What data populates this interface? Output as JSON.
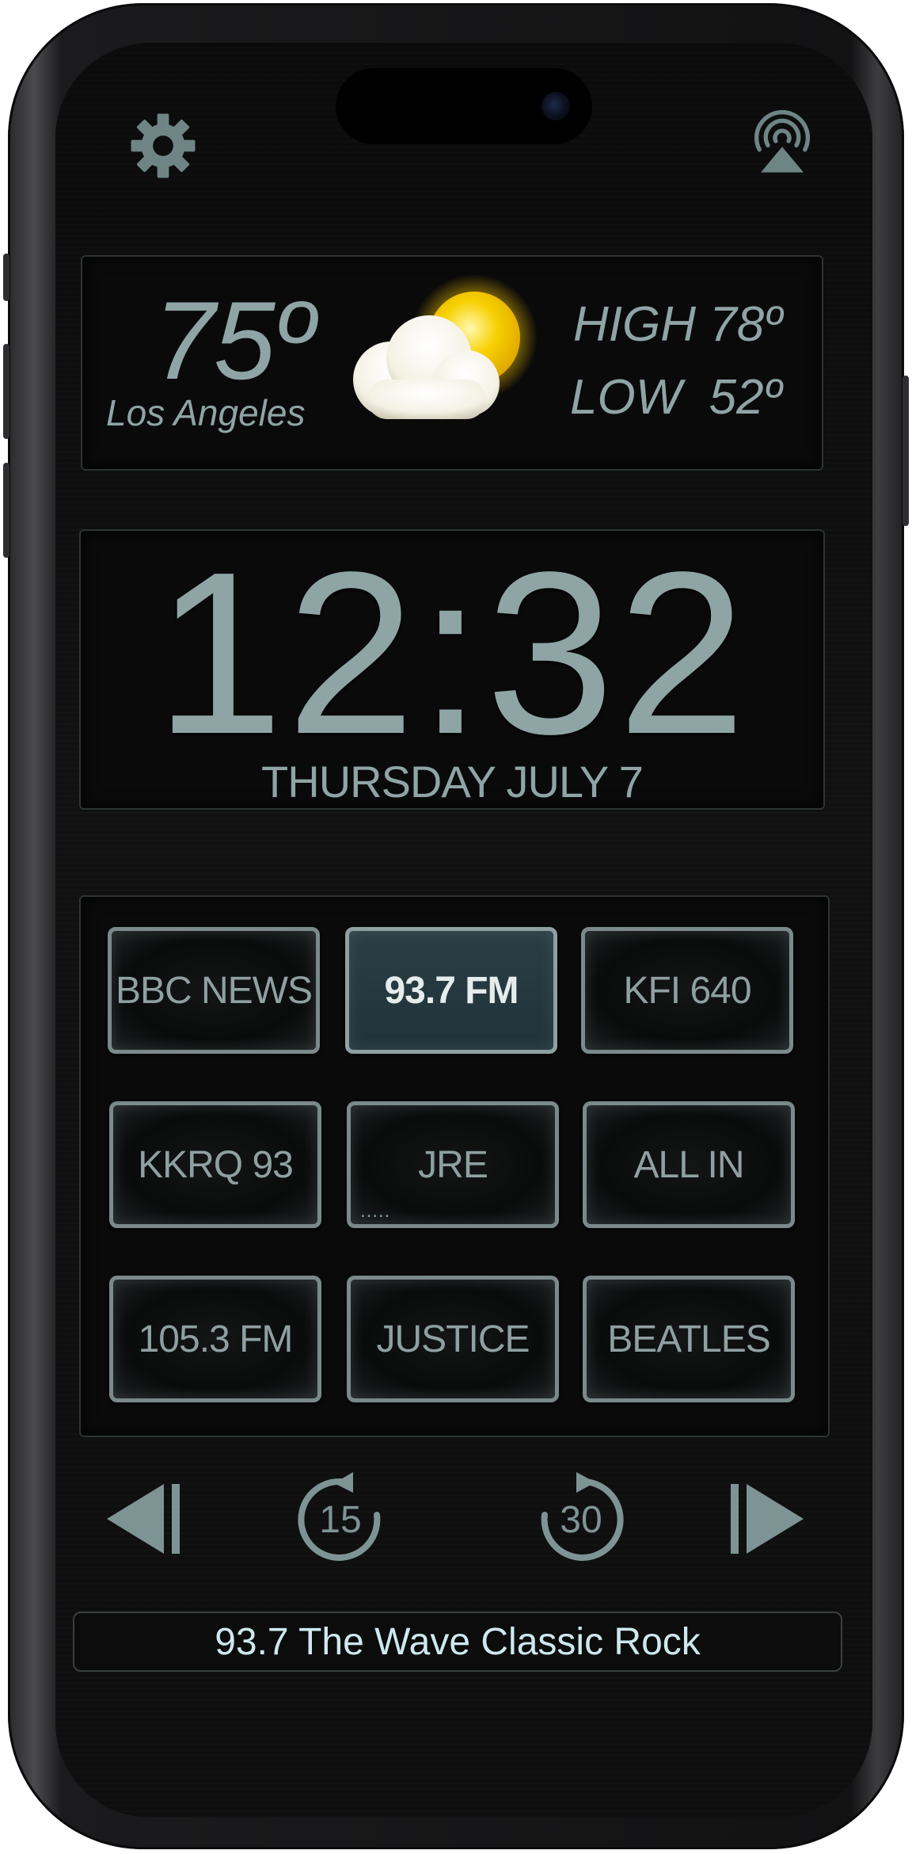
{
  "weather": {
    "temperature": "75º",
    "city": "Los Angeles",
    "high": "HIGH 78º",
    "low": "LOW  52º",
    "icon": "partly-cloudy-icon"
  },
  "clock": {
    "time": "12:32",
    "date": "THURSDAY JULY 7"
  },
  "presets": [
    {
      "label": "BBC NEWS",
      "active": false
    },
    {
      "label": "93.7 FM",
      "active": true
    },
    {
      "label": "KFI 640",
      "active": false
    },
    {
      "label": "KKRQ 93",
      "active": false
    },
    {
      "label": "JRE",
      "active": false,
      "indicator": "....."
    },
    {
      "label": "ALL IN",
      "active": false
    },
    {
      "label": "105.3 FM",
      "active": false
    },
    {
      "label": "JUSTICE",
      "active": false
    },
    {
      "label": "BEATLES",
      "active": false
    }
  ],
  "transport": {
    "skip_back_label": "15",
    "skip_forward_label": "30"
  },
  "now_playing": "93.7 The Wave Classic Rock",
  "icons": {
    "settings": "gear-icon",
    "airplay": "airplay-icon",
    "previous": "previous-track-icon",
    "rewind": "rewind-15-icon",
    "forward": "forward-30-icon",
    "next": "next-track-icon"
  },
  "colors": {
    "text": "#8fa4a5",
    "active_preset": "#253a40",
    "now_playing_text": "#cde9ee",
    "sun": "#f5c400"
  }
}
